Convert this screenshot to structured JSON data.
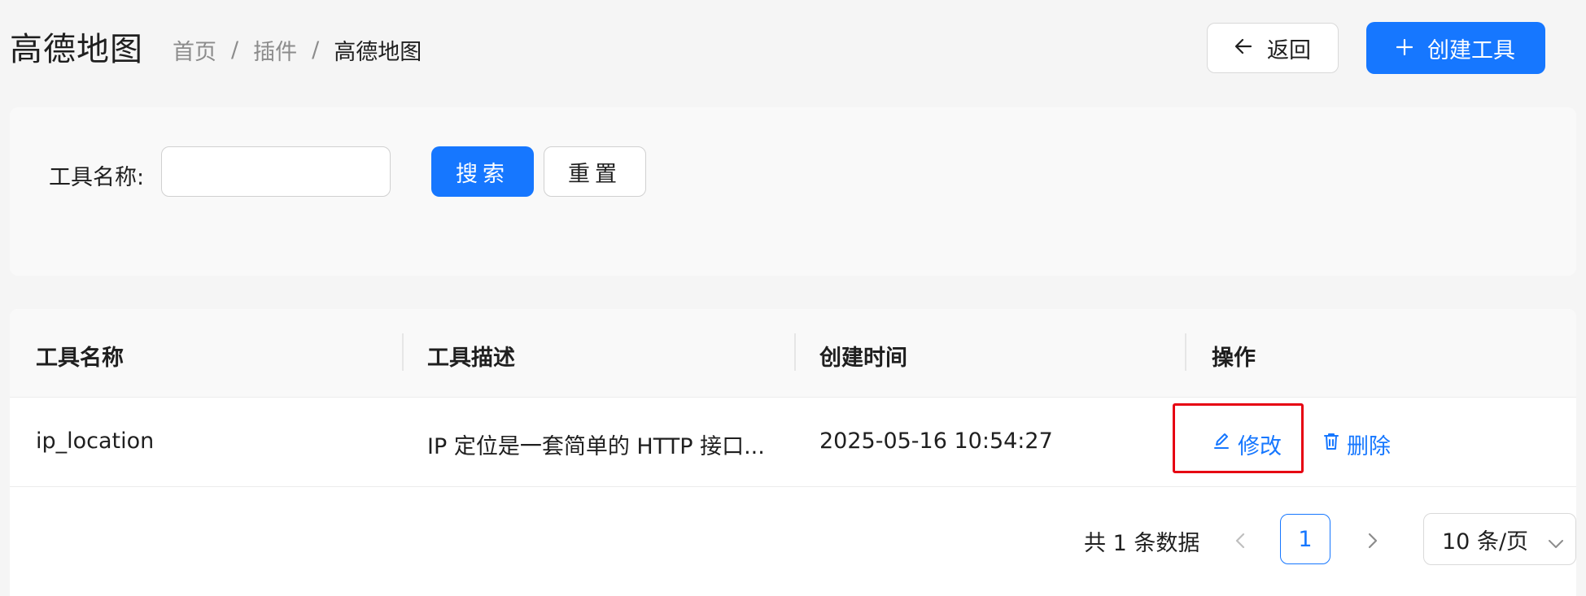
{
  "header": {
    "title": "高德地图",
    "breadcrumb": [
      "首页",
      "插件",
      "高德地图"
    ],
    "back_label": "返回",
    "create_label": "创建工具"
  },
  "search": {
    "label": "工具名称:",
    "input_value": "",
    "search_label": "搜索",
    "reset_label": "重置"
  },
  "table": {
    "columns": [
      "工具名称",
      "工具描述",
      "创建时间",
      "操作"
    ],
    "rows": [
      {
        "name": "ip_location",
        "description": "IP 定位是一套简单的 HTTP 接口...",
        "created": "2025-05-16 10:54:27",
        "edit_label": "修改",
        "delete_label": "删除"
      }
    ]
  },
  "pagination": {
    "total_text": "共 1 条数据",
    "current_page": "1",
    "page_size": "10 条/页"
  },
  "colors": {
    "primary": "#1677ff",
    "highlight": "#e60012"
  },
  "icons": [
    "arrow-left-icon",
    "plus-icon",
    "edit-icon",
    "delete-icon",
    "chevron-left-icon",
    "chevron-right-icon",
    "chevron-down-icon"
  ]
}
